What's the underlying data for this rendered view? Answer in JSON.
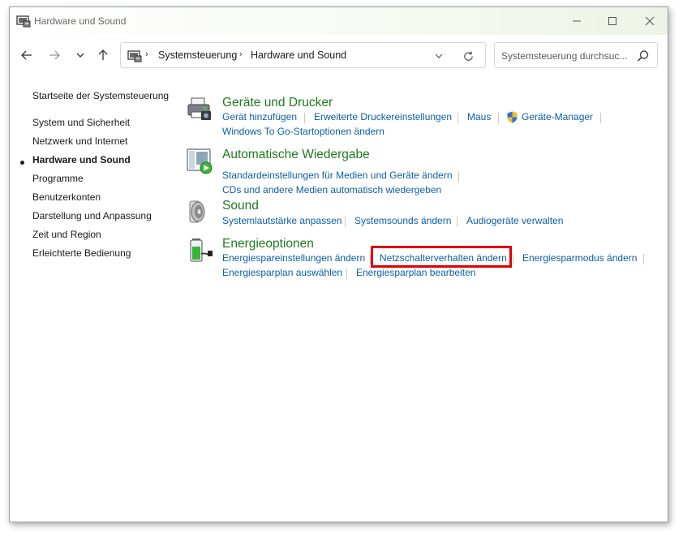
{
  "window": {
    "title": "Hardware und Sound"
  },
  "address_bar": {
    "crumbs": [
      "Systemsteuerung",
      "Hardware und Sound"
    ],
    "separator": "›"
  },
  "search": {
    "placeholder": "Systemsteuerung durchsuc..."
  },
  "sidebar": {
    "items": [
      {
        "label": "Startseite der Systemsteuerung",
        "active": false
      },
      {
        "label": "System und Sicherheit",
        "active": false
      },
      {
        "label": "Netzwerk und Internet",
        "active": false
      },
      {
        "label": "Hardware und Sound",
        "active": true
      },
      {
        "label": "Programme",
        "active": false
      },
      {
        "label": "Benutzerkonten",
        "active": false
      },
      {
        "label": "Darstellung und Anpassung",
        "active": false
      },
      {
        "label": "Zeit und Region",
        "active": false
      },
      {
        "label": "Erleichterte Bedienung",
        "active": false
      }
    ]
  },
  "categories": [
    {
      "title": "Geräte und Drucker",
      "icon": "printer-icon",
      "links": [
        "Gerät hinzufügen",
        "Erweiterte Druckereinstellungen",
        "Maus",
        "Geräte-Manager",
        "Windows To Go-Startoptionen ändern"
      ]
    },
    {
      "title": "Automatische Wiedergabe",
      "icon": "autoplay-icon",
      "links": [
        "Standardeinstellungen für Medien und Geräte ändern",
        "CDs und andere Medien automatisch wiedergeben"
      ]
    },
    {
      "title": "Sound",
      "icon": "speaker-icon",
      "links": [
        "Systemlautstärke anpassen",
        "Systemsounds ändern",
        "Audiogeräte verwalten"
      ]
    },
    {
      "title": "Energieoptionen",
      "icon": "battery-icon",
      "links": [
        "Energiespareinstellungen ändern",
        "Netzschalterverhalten ändern",
        "Energiesparmodus ändern",
        "Energiesparplan auswählen",
        "Energiesparplan bearbeiten"
      ]
    }
  ],
  "colors": {
    "category_title": "#1e7a1e",
    "link": "#0b5fa5",
    "highlight_box": "#e00000"
  }
}
